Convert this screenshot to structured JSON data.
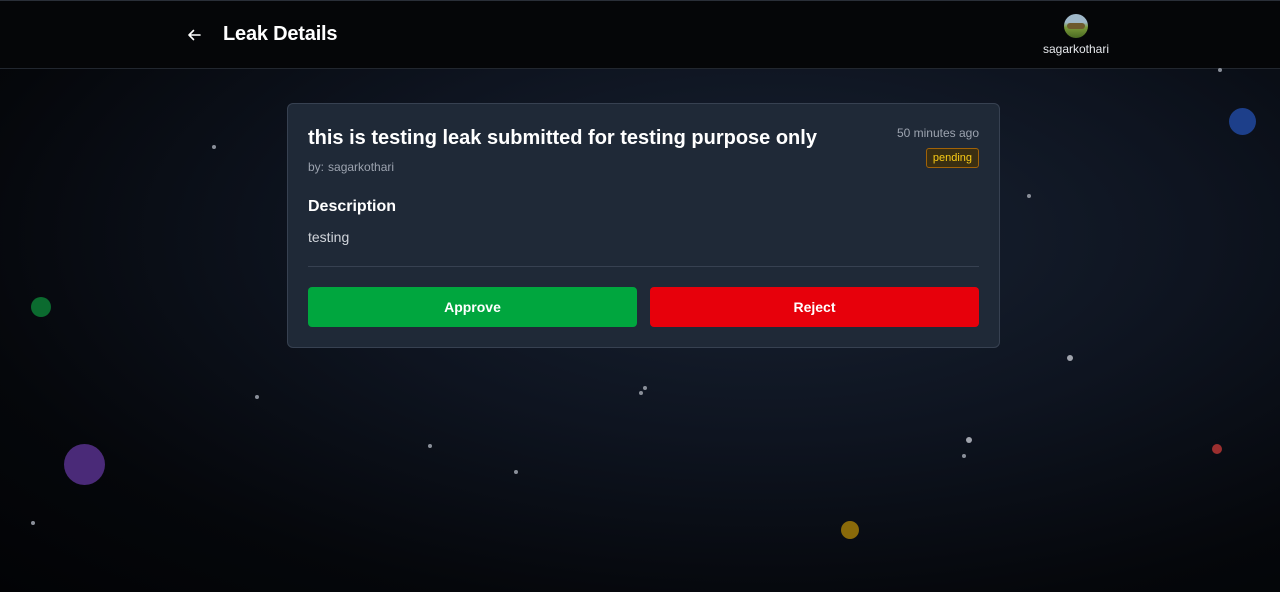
{
  "header": {
    "title": "Leak Details",
    "back_icon": "arrow-left-icon",
    "user": {
      "username": "sagarkothari",
      "avatar_icon": "avatar-image"
    }
  },
  "leak": {
    "title": "this is testing leak submitted for testing purpose only",
    "author_prefix": "by:",
    "author": "sagarkothari",
    "time_ago": "50 minutes ago",
    "status": "pending",
    "description_heading": "Description",
    "description": "testing"
  },
  "actions": {
    "approve_label": "Approve",
    "reject_label": "Reject"
  },
  "colors": {
    "card_bg": "#1f2937",
    "approve": "#00a63e",
    "reject": "#e7000b",
    "status_text": "#facc15"
  }
}
